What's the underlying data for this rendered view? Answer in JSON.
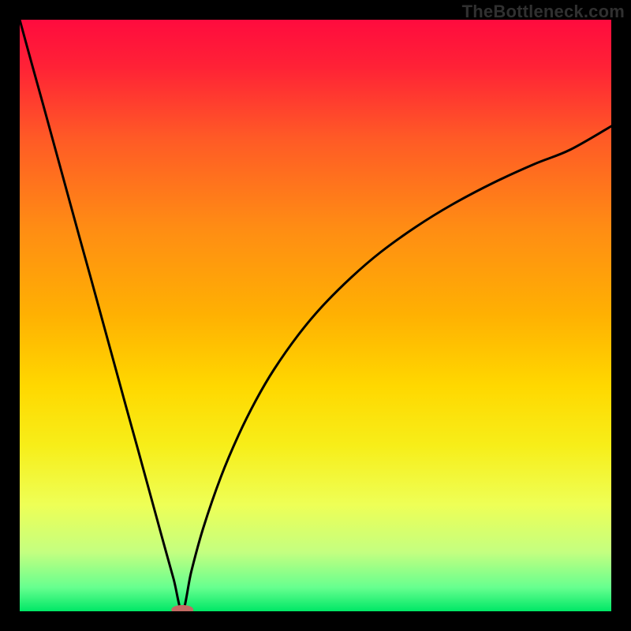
{
  "watermark": "TheBottleneck.com",
  "chart_data": {
    "type": "line",
    "title": "",
    "xlabel": "",
    "ylabel": "",
    "xlim": [
      0,
      100
    ],
    "ylim": [
      0,
      100
    ],
    "curve_note": "Estimated bottleneck-style V curve; minimum at x≈27.5, steep left branch, asymptotic right branch topping near y≈82 at x=100.",
    "series": [
      {
        "name": "bottleneck-curve",
        "x": [
          0,
          2,
          4,
          6,
          8,
          10,
          12,
          14,
          16,
          18,
          20,
          22,
          24,
          26,
          27.5,
          29,
          31,
          34,
          37,
          40,
          43,
          47,
          51,
          56,
          61,
          67,
          73,
          80,
          87,
          93,
          100
        ],
        "y": [
          100,
          92.7,
          85.5,
          78.2,
          70.9,
          63.6,
          56.4,
          49.1,
          41.8,
          34.5,
          27.3,
          20.0,
          12.7,
          5.5,
          0,
          6.7,
          14.0,
          22.7,
          29.8,
          35.8,
          40.9,
          46.6,
          51.4,
          56.4,
          60.7,
          65.0,
          68.7,
          72.4,
          75.6,
          78.0,
          82.0
        ]
      }
    ],
    "gradient_stops": [
      {
        "offset": 0.0,
        "color": "#ff0b3e"
      },
      {
        "offset": 0.08,
        "color": "#ff2236"
      },
      {
        "offset": 0.2,
        "color": "#ff5a26"
      },
      {
        "offset": 0.35,
        "color": "#ff8c14"
      },
      {
        "offset": 0.5,
        "color": "#ffb102"
      },
      {
        "offset": 0.62,
        "color": "#ffd800"
      },
      {
        "offset": 0.72,
        "color": "#f7ee19"
      },
      {
        "offset": 0.82,
        "color": "#eeff56"
      },
      {
        "offset": 0.9,
        "color": "#c4ff80"
      },
      {
        "offset": 0.96,
        "color": "#66ff8f"
      },
      {
        "offset": 1.0,
        "color": "#00e766"
      }
    ],
    "dip_marker": {
      "x": 27.5,
      "y": 0,
      "rx": 14,
      "ry": 6,
      "color": "#c36a63"
    }
  }
}
